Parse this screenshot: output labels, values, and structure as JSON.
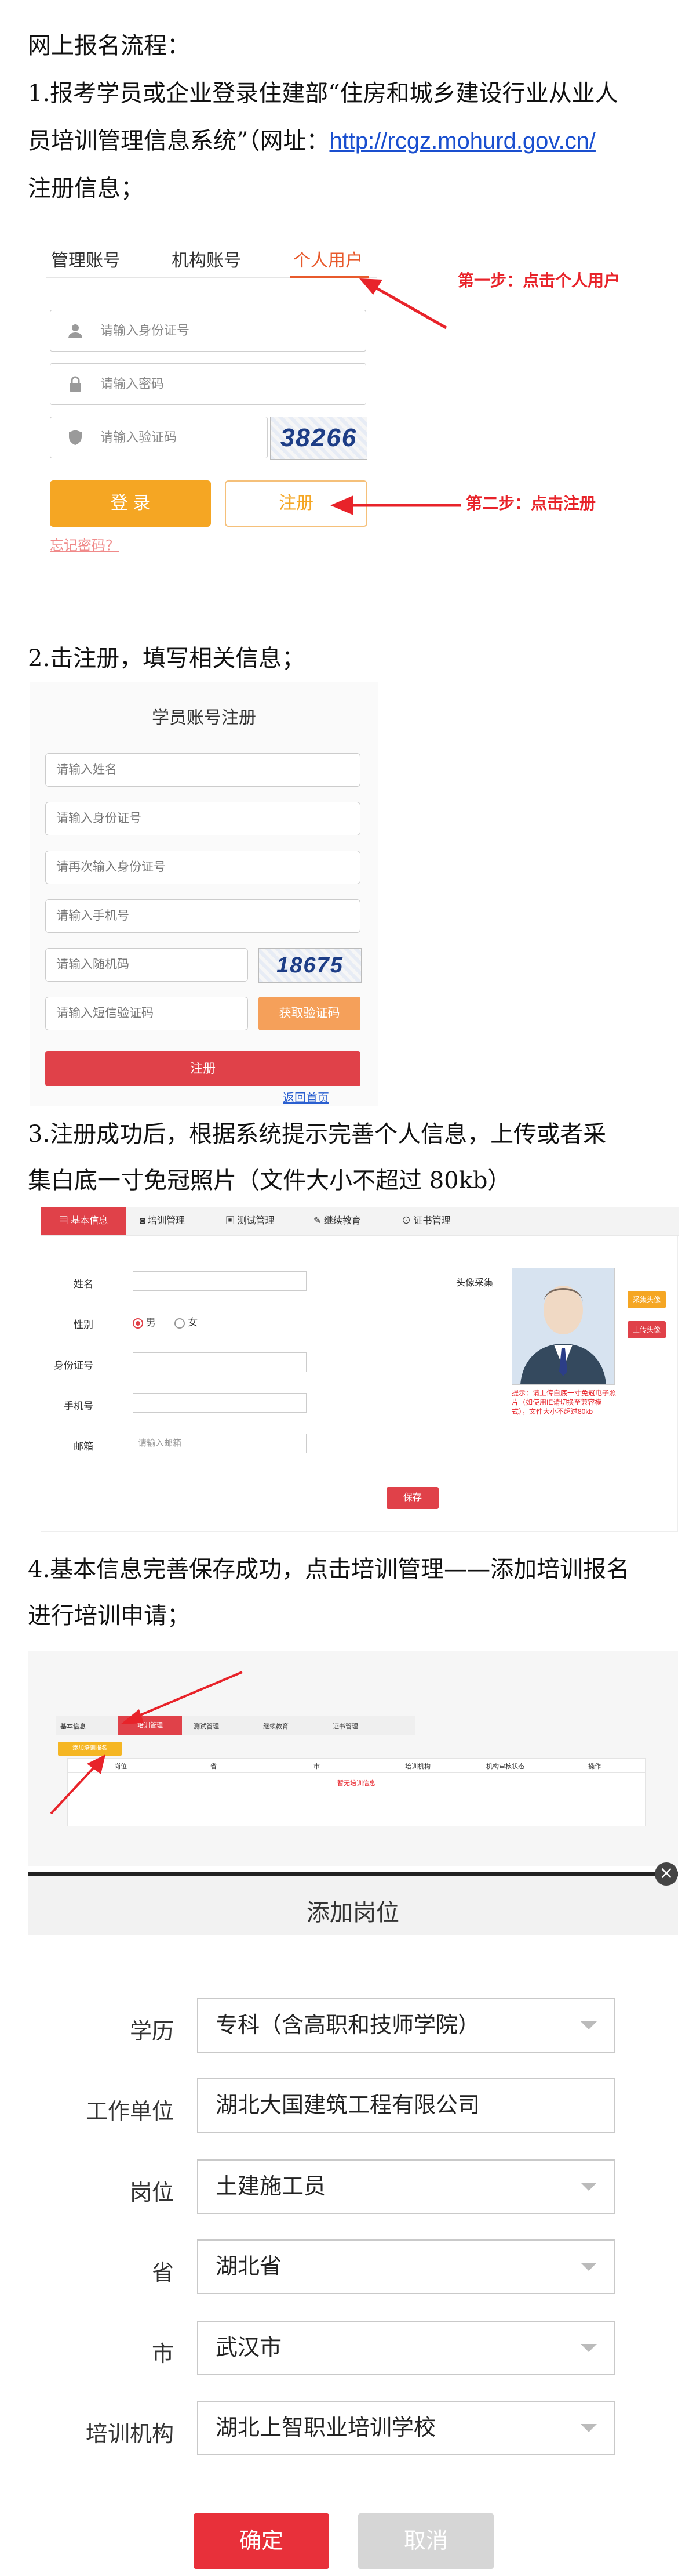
{
  "heading": "网上报名流程：",
  "step1": {
    "para_line1": "1.报考学员或企业登录住建部“住房和城乡建设行业从业人",
    "para_line2_prefix": "员培训管理信息系统”（网址：",
    "url": "http://rcgz.mohurd.gov.cn/",
    "para_line3": "注册信息；",
    "tabs": [
      "管理账号",
      "机构账号",
      "个人用户"
    ],
    "fields": [
      "请输入身份证号",
      "请输入密码",
      "请输入验证码"
    ],
    "captcha": "38266",
    "login_button": "登 录",
    "register_button": "注册",
    "forgot": "忘记密码？",
    "note1": "第一步：点击个人用户",
    "note2": "第二步：点击注册"
  },
  "step2": {
    "para": "2.击注册，填写相关信息；",
    "title": "学员账号注册",
    "fields": [
      "请输入姓名",
      "请输入身份证号",
      "请再次输入身份证号",
      "请输入手机号",
      "请输入随机码",
      "请输入短信验证码"
    ],
    "captcha": "18675",
    "get_code": "获取验证码",
    "register": "注册",
    "back_home": "返回首页"
  },
  "step3": {
    "para_line1": "3.注册成功后，根据系统提示完善个人信息，上传或者采",
    "para_line2": "集白底一寸免冠照片（文件大小不超过 80kb）",
    "nav": [
      "基本信息",
      "培训管理",
      "测试管理",
      "继续教育",
      "证书管理"
    ],
    "labels": {
      "name": "姓名",
      "gender": "性别",
      "id": "身份证号",
      "phone": "手机号",
      "email": "邮箱"
    },
    "gender_options": [
      "男",
      "女"
    ],
    "email_placeholder": "请输入邮箱",
    "photo_label": "头像采集",
    "collect_btn": "采集头像",
    "upload_btn": "上传头像",
    "tip": "提示：请上传白底一寸免冠电子照片（如使用IE请切换至兼容模式），文件大小不超过80kb",
    "save": "保存"
  },
  "step4": {
    "para_line1": "4.基本信息完善保存成功，点击培训管理——添加培训报名",
    "para_line2": "进行培训申请；",
    "nav": [
      "基本信息",
      "培训管理",
      "测试管理",
      "继续教育",
      "证书管理"
    ],
    "add_btn": "添加培训报名",
    "table_headers": [
      "岗位",
      "省",
      "市",
      "培训机构",
      "机构审核状态",
      "操作"
    ],
    "empty": "暂无培训信息",
    "modal": {
      "title": "添加岗位",
      "close": "×",
      "rows": [
        {
          "label": "学历",
          "value": "专科（含高职和技师学院）",
          "dropdown": true
        },
        {
          "label": "工作单位",
          "value": "湖北大国建筑工程有限公司",
          "dropdown": false
        },
        {
          "label": "岗位",
          "value": "土建施工员",
          "dropdown": true
        },
        {
          "label": "省",
          "value": "湖北省",
          "dropdown": true
        },
        {
          "label": "市",
          "value": "武汉市",
          "dropdown": true
        },
        {
          "label": "培训机构",
          "value": "湖北上智职业培训学校",
          "dropdown": true
        }
      ],
      "confirm": "确定",
      "cancel": "取消"
    }
  },
  "colors": {
    "accent_red": "#e8303a",
    "orange": "#f5a623",
    "link": "#1a4fcf"
  }
}
